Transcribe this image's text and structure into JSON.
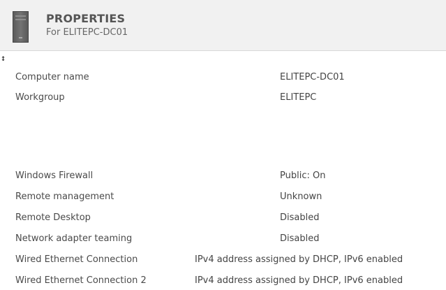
{
  "header": {
    "title": "PROPERTIES",
    "subtitle": "For ELITEPC-DC01",
    "icon": "server-icon"
  },
  "properties": {
    "group1": [
      {
        "label": "Computer name",
        "value": "ELITEPC-DC01"
      },
      {
        "label": "Workgroup",
        "value": "ELITEPC"
      }
    ],
    "group2": [
      {
        "label": "Windows Firewall",
        "value": "Public: On"
      },
      {
        "label": "Remote management",
        "value": "Unknown"
      },
      {
        "label": "Remote Desktop",
        "value": "Disabled"
      },
      {
        "label": "Network adapter teaming",
        "value": "Disabled"
      },
      {
        "label": "Wired Ethernet Connection",
        "value": "IPv4 address assigned by DHCP, IPv6 enabled"
      },
      {
        "label": "Wired Ethernet Connection 2",
        "value": "IPv4 address assigned by DHCP, IPv6 enabled"
      }
    ]
  }
}
